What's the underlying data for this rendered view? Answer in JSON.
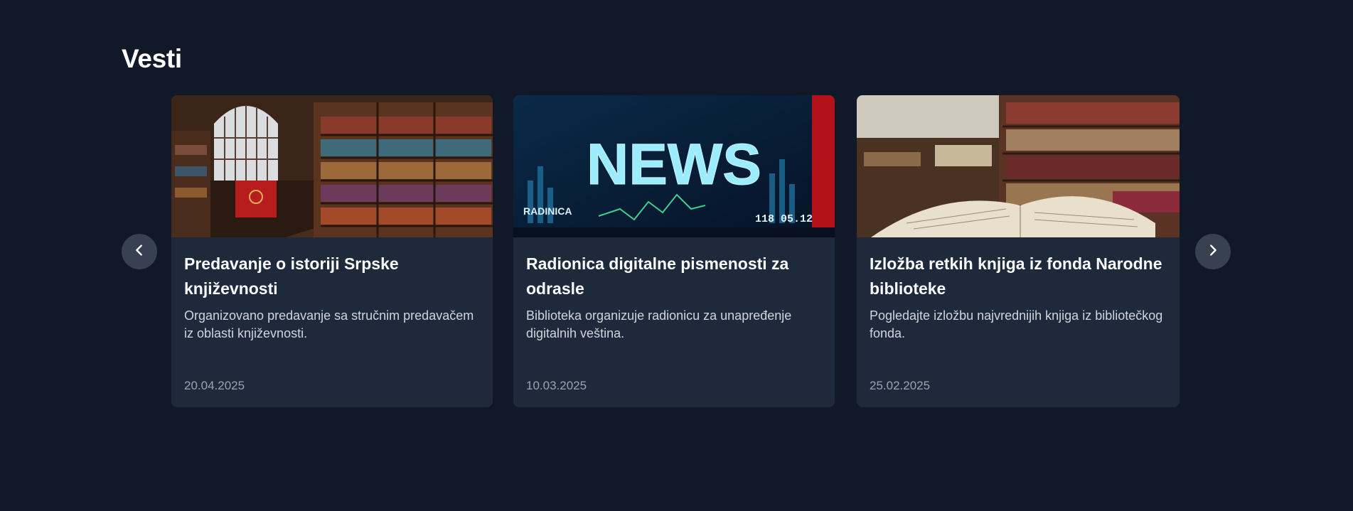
{
  "section": {
    "title": "Vesti"
  },
  "nav": {
    "prev_icon": "chevron-left-icon",
    "next_icon": "chevron-right-icon"
  },
  "news": [
    {
      "title": "Predavanje o istoriji Srpske književnosti",
      "description": "Organizovano predavanje sa stručnim predavačem iz oblasti književnosti.",
      "date": "20.04.2025",
      "image": "library-hall-image"
    },
    {
      "title": "Radionica digitalne pismenosti za odrasle",
      "description": "Biblioteka organizuje radionicu za unapređenje digitalnih veština.",
      "date": "10.03.2025",
      "image": "news-screen-image",
      "image_text": {
        "headline": "NEWS",
        "caption": "RADINICA",
        "ticker": "118 05.12"
      }
    },
    {
      "title": "Izložba retkih knjiga iz fonda Narodne biblioteke",
      "description": "Pogledajte izložbu najvrednijih knjiga iz bibliotečkog fonda.",
      "date": "25.02.2025",
      "image": "open-book-image"
    }
  ]
}
